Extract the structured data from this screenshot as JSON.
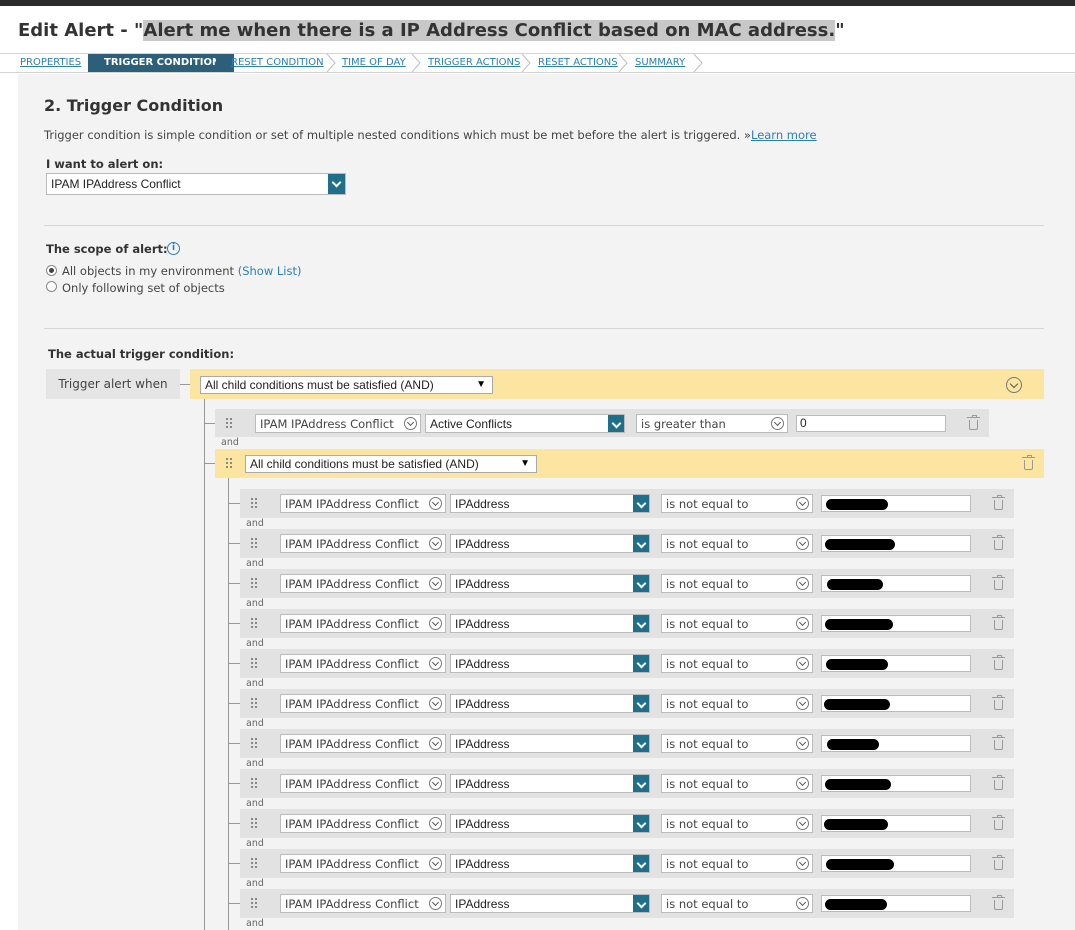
{
  "page": {
    "title_prefix": "Edit Alert - \"",
    "title_highlight": "Alert me when there is a IP Address Conflict based on MAC address.",
    "title_suffix": "\""
  },
  "wizard": {
    "steps": [
      "PROPERTIES",
      "TRIGGER CONDITION",
      "RESET CONDITION",
      "TIME OF DAY",
      "TRIGGER ACTIONS",
      "RESET ACTIONS",
      "SUMMARY"
    ],
    "active_step": "TRIGGER CONDITION"
  },
  "section": {
    "heading": "2. Trigger Condition",
    "description": "Trigger condition is simple condition or set of multiple nested conditions which must be met before the alert is triggered. »",
    "learn_more": "Learn more"
  },
  "alert_on": {
    "label": "I want to alert on:",
    "value": "IPAM IPAddress Conflict"
  },
  "scope": {
    "label": "The scope of alert:",
    "option_all": "All objects in my environment",
    "show_list": "(Show List)",
    "option_following": "Only following set of objects",
    "selected": "all"
  },
  "trigger": {
    "heading": "The actual trigger condition:",
    "when_label": "Trigger alert when",
    "top_group": "All child conditions must be satisfied (AND)",
    "first_condition": {
      "object": "IPAM IPAddress Conflict",
      "field": "Active Conflicts",
      "operator": "is greater than",
      "value": "0"
    },
    "and_label": "and",
    "nested_group": "All child conditions must be satisfied (AND)",
    "nested_conditions": [
      {
        "object": "IPAM IPAddress Conflict",
        "field": "IPAddress",
        "operator": "is not equal to"
      },
      {
        "object": "IPAM IPAddress Conflict",
        "field": "IPAddress",
        "operator": "is not equal to"
      },
      {
        "object": "IPAM IPAddress Conflict",
        "field": "IPAddress",
        "operator": "is not equal to"
      },
      {
        "object": "IPAM IPAddress Conflict",
        "field": "IPAddress",
        "operator": "is not equal to"
      },
      {
        "object": "IPAM IPAddress Conflict",
        "field": "IPAddress",
        "operator": "is not equal to"
      },
      {
        "object": "IPAM IPAddress Conflict",
        "field": "IPAddress",
        "operator": "is not equal to"
      },
      {
        "object": "IPAM IPAddress Conflict",
        "field": "IPAddress",
        "operator": "is not equal to"
      },
      {
        "object": "IPAM IPAddress Conflict",
        "field": "IPAddress",
        "operator": "is not equal to"
      },
      {
        "object": "IPAM IPAddress Conflict",
        "field": "IPAddress",
        "operator": "is not equal to"
      },
      {
        "object": "IPAM IPAddress Conflict",
        "field": "IPAddress",
        "operator": "is not equal to"
      },
      {
        "object": "IPAM IPAddress Conflict",
        "field": "IPAddress",
        "operator": "is not equal to"
      }
    ]
  },
  "colors": {
    "accent": "#1f6f8b",
    "active_step": "#2c5f7a",
    "group_bar": "#fbe5a0",
    "link": "#2980b9"
  }
}
